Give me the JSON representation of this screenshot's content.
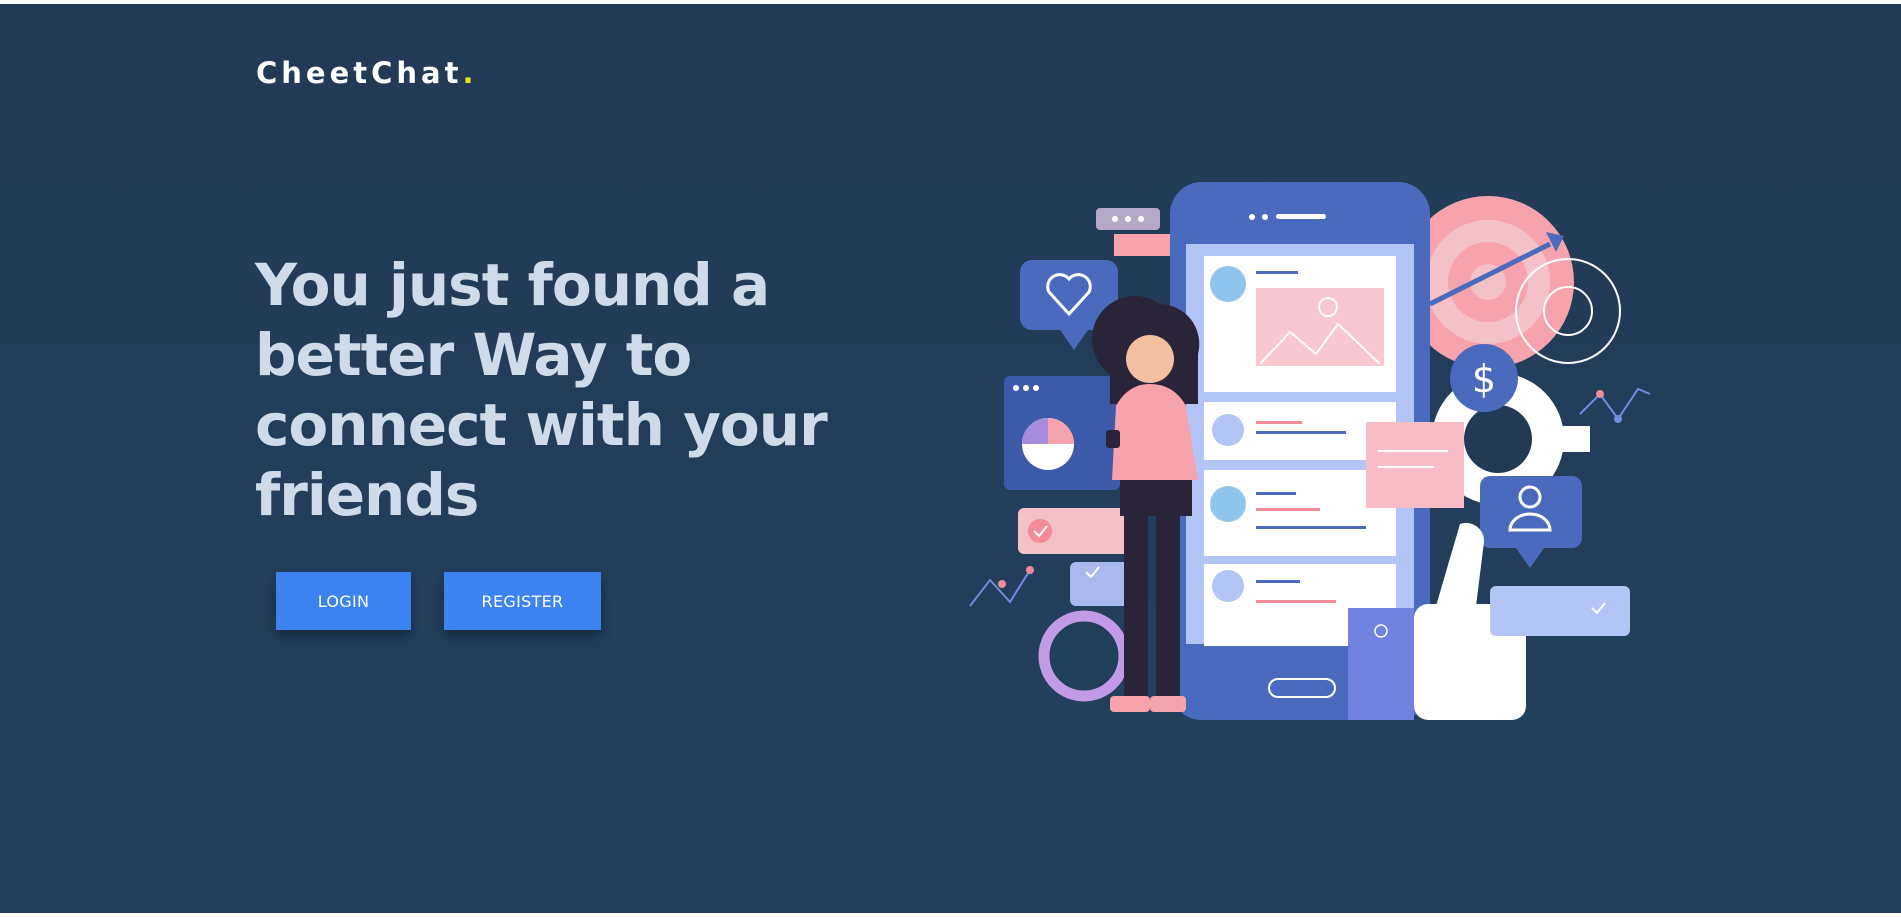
{
  "brand": {
    "name": "CheetChat",
    "dot": "."
  },
  "hero": {
    "headline": "You just found a better Way to connect with your friends"
  },
  "actions": {
    "login_label": "LOGIN",
    "register_label": "REGISTER"
  },
  "colors": {
    "background": "#233a55",
    "headline": "#cfdbe9",
    "button": "#3c82f0",
    "logo_accent": "#f5e11b"
  }
}
